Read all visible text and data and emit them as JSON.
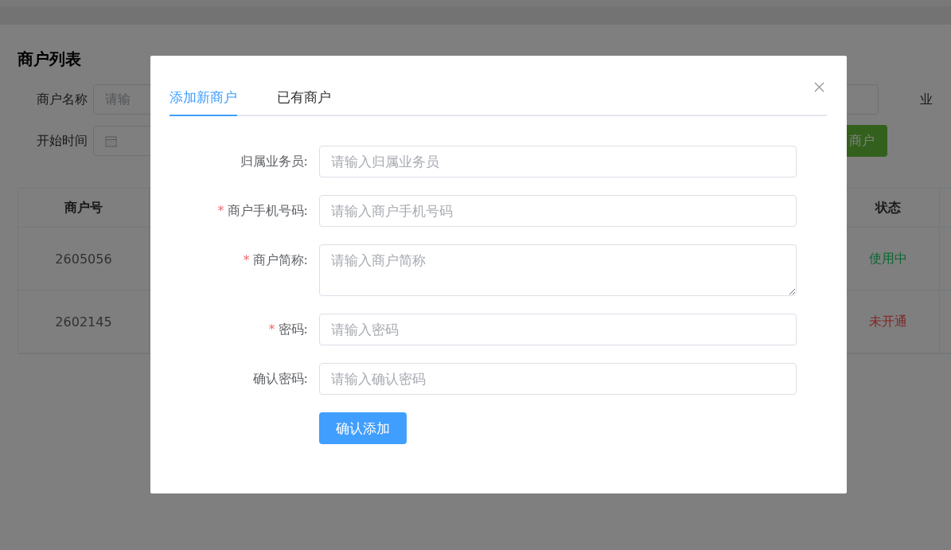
{
  "page": {
    "title": "商户列表",
    "filters": [
      {
        "kind": "text",
        "label": "商户名称",
        "placeholder": "请输"
      },
      {
        "kind": "date",
        "label": "开始时间"
      }
    ],
    "right_label": "业",
    "add_button": "商户",
    "table": {
      "columns": [
        "商户号",
        "状态"
      ],
      "rows": [
        {
          "id": "2605056",
          "status": "使用中",
          "color": "#0a6733"
        },
        {
          "id": "2602145",
          "status": "未开通",
          "color": "#802424"
        }
      ]
    }
  },
  "dialog": {
    "tabs": [
      {
        "label": "添加新商户",
        "selected": true
      },
      {
        "label": "已有商户",
        "selected": false
      }
    ],
    "fields": [
      {
        "kind": "input",
        "label": "归属业务员:",
        "placeholder": "请输入归属业务员"
      },
      {
        "kind": "input",
        "required_mark": "*",
        "label": "商户手机号码:",
        "placeholder": "请输入商户手机号码"
      },
      {
        "kind": "textarea",
        "required_mark": "*",
        "label": "商户简称:",
        "placeholder": "请输入商户简称"
      },
      {
        "kind": "input",
        "required_mark": "*",
        "label": "密码:",
        "placeholder": "请输入密码"
      },
      {
        "kind": "input",
        "label": "确认密码:",
        "placeholder": "请输入确认密码"
      }
    ],
    "submit": "确认添加"
  }
}
